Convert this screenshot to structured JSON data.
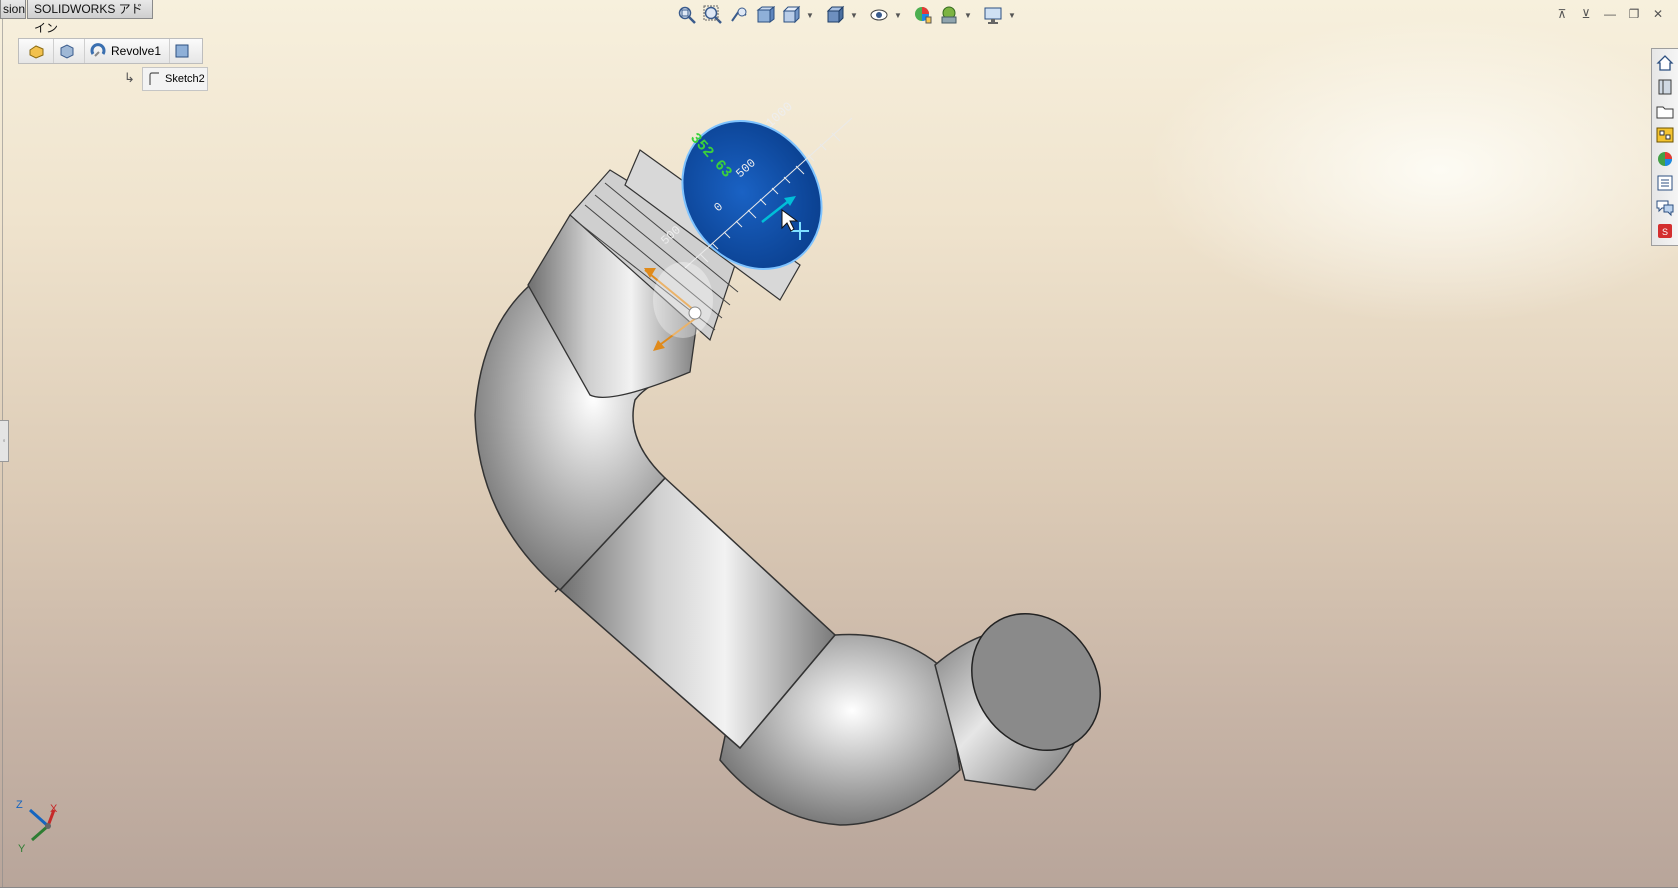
{
  "tabs": [
    {
      "label": "sion"
    },
    {
      "label": "SOLIDWORKS アドイン"
    }
  ],
  "breadcrumb": {
    "feature": "Revolve1",
    "sketch": "Sketch2"
  },
  "triad_ruler": {
    "value": "352.63",
    "ticks": [
      "1000",
      "500",
      "0",
      "500"
    ]
  },
  "axes": {
    "x": "X",
    "y": "Y",
    "z": "Z"
  },
  "toolbar_icons": [
    "zoom-to-fit-icon",
    "zoom-area-icon",
    "previous-view-icon",
    "section-view-icon",
    "view-orientation-icon",
    "display-style-icon",
    "hide-show-icon",
    "edit-appearance-icon",
    "apply-scene-icon",
    "view-settings-icon"
  ],
  "taskpane_icons": [
    "home-icon",
    "design-library-icon",
    "file-explorer-icon",
    "view-palette-icon",
    "appearances-icon",
    "custom-properties-icon",
    "forum-icon",
    "solidworks-resources-icon"
  ],
  "colors": {
    "face_select": "#0a4fa8",
    "dim_value": "#3bd13b",
    "drag_arrow": "#e08a1a"
  }
}
